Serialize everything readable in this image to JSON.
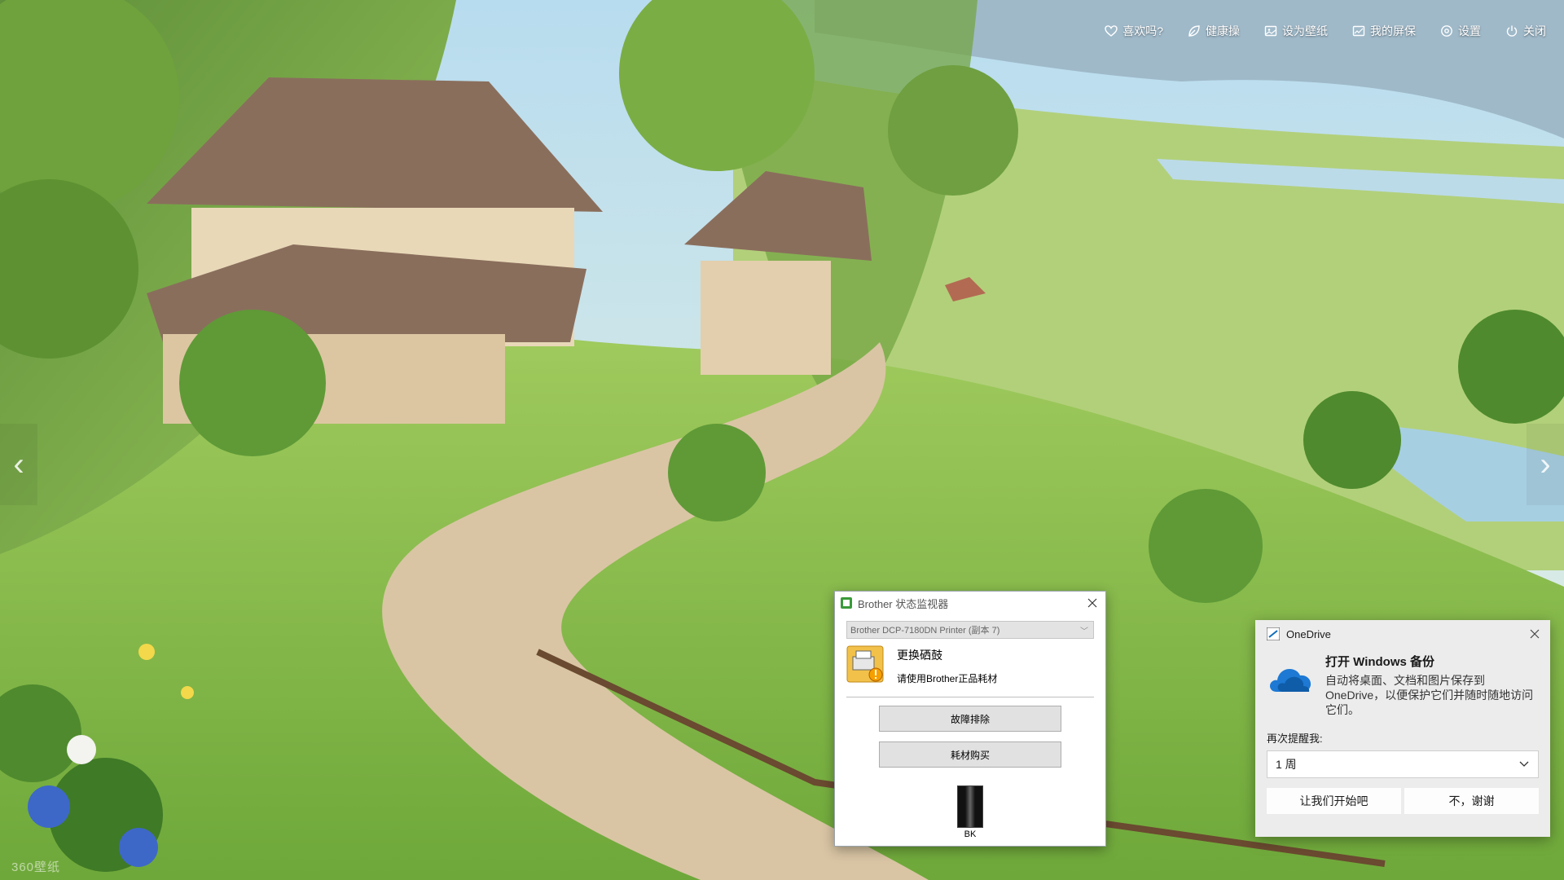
{
  "toolbar": {
    "items": [
      {
        "label": "喜欢吗?",
        "icon": "heart-icon"
      },
      {
        "label": "健康操",
        "icon": "leaf-icon"
      },
      {
        "label": "设为壁纸",
        "icon": "picture-icon"
      },
      {
        "label": "我的屏保",
        "icon": "screensaver-icon"
      },
      {
        "label": "设置",
        "icon": "gear-icon"
      },
      {
        "label": "关闭",
        "icon": "power-icon"
      }
    ]
  },
  "nav": {
    "prev": "‹",
    "next": "›"
  },
  "watermark": "360壁纸",
  "brother": {
    "title": "Brother 状态监视器",
    "printer_select": "Brother DCP-7180DN Printer (副本 7)",
    "status_main": "更换硒鼓",
    "status_sub": "请使用Brother正品耗材",
    "troubleshoot_label": "故障排除",
    "buy_supplies_label": "耗材购买",
    "ink_label": "BK"
  },
  "onedrive": {
    "app_name": "OneDrive",
    "title": "打开 Windows 备份",
    "description": "自动将桌面、文档和图片保存到 OneDrive，以便保护它们并随时随地访问它们。",
    "remind_label": "再次提醒我:",
    "remind_value": "1 周",
    "start_label": "让我们开始吧",
    "decline_label": "不，谢谢"
  },
  "colors": {
    "sky": "#a9d3ea",
    "grass": "#8cc152",
    "onedrive_blue": "#0f6cbd",
    "toast_bg": "#ececec"
  }
}
